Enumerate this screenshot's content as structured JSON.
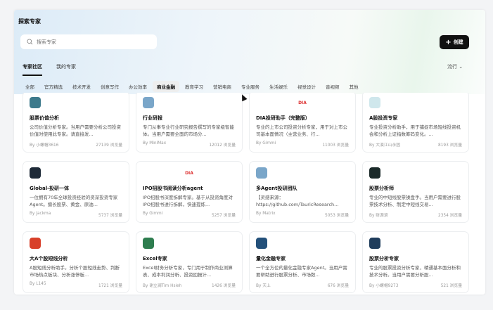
{
  "header": {
    "title": "探索专家",
    "search_placeholder": "搜索专家",
    "create_label": "创建"
  },
  "tabs": [
    {
      "label": "专家社区",
      "active": true
    },
    {
      "label": "我的专家",
      "active": false
    }
  ],
  "sort": {
    "label": "流行"
  },
  "categories": [
    "全部",
    "官方精选",
    "技术开发",
    "创意写作",
    "办公效率",
    "商业金融",
    "教育学习",
    "营销电商",
    "专业服务",
    "生活娱乐",
    "视觉设计",
    "音视频",
    "其他"
  ],
  "active_category": "商业金融",
  "cards": [
    {
      "title": "股票价值分析",
      "desc": "公司价值分析专家。当用户需要分析公司投资价值时使用此专家。请直接发...",
      "author": "By 小螺帽3616",
      "views": "27139 浏览量",
      "icon": "stock-value-icon",
      "color": "#3d7a8c"
    },
    {
      "title": "行业研报",
      "desc": "专门从事专业行业研究报告撰写的专家级智能体。当用户需要全面的市场分...",
      "author": "By MiniMax",
      "views": "12012 浏览量",
      "icon": "document-icon",
      "color": "#7aa6c9"
    },
    {
      "title": "DIA投研助手（完整版）",
      "desc": "专业的上市公司投资分析专家，用于对上市公司基本面情况（主营业务、行...",
      "author": "By Gimmi",
      "views": "11003 浏览量",
      "icon": "dia-logo-icon",
      "color": "#d33"
    },
    {
      "title": "A股投资专家",
      "desc": "专业投资分析助手，用于捕捉市场短线投资机会和分析上证指数筹码变化。...",
      "author": "By 大漠江山永固",
      "views": "8193 浏览量",
      "icon": "chart-magnifier-icon",
      "color": "#cfe7ec"
    },
    {
      "title": "Global-投研一体",
      "desc": "一位拥有70年全球投资经验的资深投资专家Agent。擅长股票、黄金、原油...",
      "author": "By Jackma",
      "views": "5737 浏览量",
      "icon": "bull-icon",
      "color": "#1e2a38"
    },
    {
      "title": "IPO招股书阅读分析agent",
      "desc": "IPO招股书深度拆解专家。基于从投资角度对IPO招股书进行拆解，快速提炼...",
      "author": "By Gimmi",
      "views": "5257 浏览量",
      "icon": "dia-logo-icon",
      "color": "#d33"
    },
    {
      "title": "多Agent投研团队",
      "desc": "【灵感来源：https://github.com/TauricResearch...",
      "author": "By Matrix",
      "views": "5053 浏览量",
      "icon": "candlestick-icon",
      "color": "#7aa6c9"
    },
    {
      "title": "股票分析师",
      "desc": "专业的中短线股票操盘手。当用户需要进行股票技术分析、制定中短线交易...",
      "author": "By 财源滚",
      "views": "2354 浏览量",
      "icon": "trend-chart-icon",
      "color": "#1b2a2a"
    },
    {
      "title": "大A个股短线分析",
      "desc": "A股短线分析助手。分析个股短线走势、判断市场热点板块、分析涨停板...",
      "author": "By L145",
      "views": "1721 浏览量",
      "icon": "red-chart-icon",
      "color": "#d8402a"
    },
    {
      "title": "Excel专家",
      "desc": "Excel财务分析专家，专门用于制作商业测算表、成本利润分析、投资回报计...",
      "author": "By 谢立澜Tim Hsieh",
      "views": "1426 浏览量",
      "icon": "excel-icon",
      "color": "#2e7d4f"
    },
    {
      "title": "量化金融专家",
      "desc": "一个全方位的量化金融专家Agent。当用户需要帮助进行股票分析、市场数...",
      "author": "By 天上",
      "views": "676 浏览量",
      "icon": "quant-globe-icon",
      "color": "#23507a"
    },
    {
      "title": "股票分析专家",
      "desc": "专业的股票投资分析专家，精通基本面分析和技术分析。当用户需要分析股...",
      "author": "By 小螺帽9273",
      "views": "521 浏览量",
      "icon": "stock-chart-icon",
      "color": "#1f3d5c"
    }
  ]
}
